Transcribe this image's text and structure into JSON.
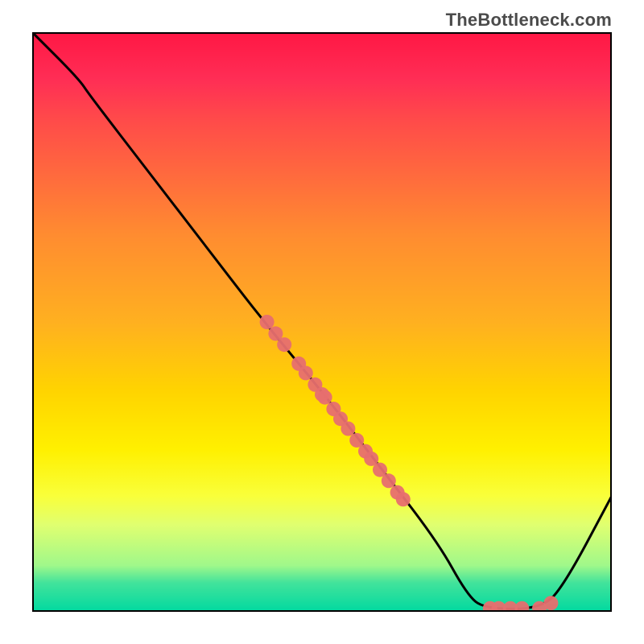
{
  "attribution": "TheBottleneck.com",
  "chart_data": {
    "type": "line",
    "title": "",
    "xlabel": "",
    "ylabel": "",
    "xlim": [
      0,
      100
    ],
    "ylim": [
      0,
      100
    ],
    "curve": [
      {
        "x": 0,
        "y": 100
      },
      {
        "x": 8,
        "y": 92
      },
      {
        "x": 10,
        "y": 89
      },
      {
        "x": 20,
        "y": 76
      },
      {
        "x": 30,
        "y": 63
      },
      {
        "x": 40,
        "y": 50
      },
      {
        "x": 50,
        "y": 38
      },
      {
        "x": 60,
        "y": 25
      },
      {
        "x": 70,
        "y": 12
      },
      {
        "x": 75,
        "y": 3
      },
      {
        "x": 78,
        "y": 0.5
      },
      {
        "x": 88,
        "y": 0.5
      },
      {
        "x": 92,
        "y": 5
      },
      {
        "x": 100,
        "y": 20
      }
    ],
    "scatter": [
      {
        "x": 40.5,
        "y": 50.0
      },
      {
        "x": 42.0,
        "y": 48.0
      },
      {
        "x": 43.5,
        "y": 46.1
      },
      {
        "x": 46.0,
        "y": 42.8
      },
      {
        "x": 47.2,
        "y": 41.2
      },
      {
        "x": 48.8,
        "y": 39.2
      },
      {
        "x": 50.0,
        "y": 37.5
      },
      {
        "x": 50.5,
        "y": 37.0
      },
      {
        "x": 52.0,
        "y": 35.0
      },
      {
        "x": 53.2,
        "y": 33.3
      },
      {
        "x": 54.5,
        "y": 31.6
      },
      {
        "x": 56.0,
        "y": 29.6
      },
      {
        "x": 57.5,
        "y": 27.7
      },
      {
        "x": 58.5,
        "y": 26.4
      },
      {
        "x": 60.0,
        "y": 24.5
      },
      {
        "x": 61.5,
        "y": 22.6
      },
      {
        "x": 63.0,
        "y": 20.6
      },
      {
        "x": 64.0,
        "y": 19.4
      },
      {
        "x": 79.0,
        "y": 0.6
      },
      {
        "x": 80.5,
        "y": 0.6
      },
      {
        "x": 82.5,
        "y": 0.6
      },
      {
        "x": 84.5,
        "y": 0.6
      },
      {
        "x": 87.5,
        "y": 0.6
      },
      {
        "x": 89.5,
        "y": 1.5
      }
    ],
    "colors": {
      "gradient_top": "#ff1744",
      "gradient_bottom": "#00d9a0",
      "line": "#000000",
      "marker": "#e76f6f"
    }
  }
}
